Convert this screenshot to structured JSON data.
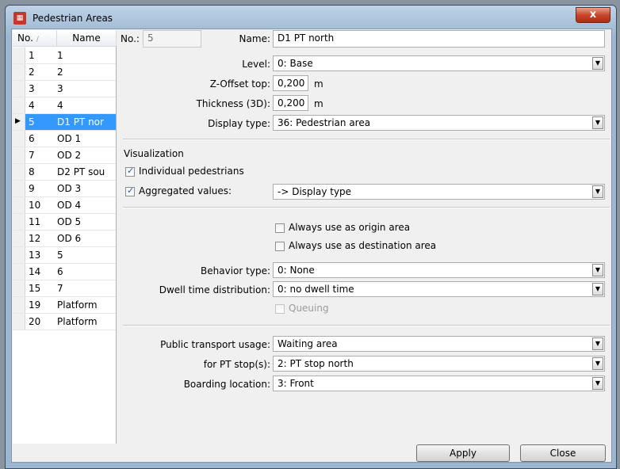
{
  "window": {
    "title": "Pedestrian Areas",
    "close_glyph": "x"
  },
  "list": {
    "headers": {
      "no": "No.",
      "name": "Name"
    },
    "rows": [
      {
        "no": "1",
        "name": "1"
      },
      {
        "no": "2",
        "name": "2"
      },
      {
        "no": "3",
        "name": "3"
      },
      {
        "no": "4",
        "name": "4"
      },
      {
        "no": "5",
        "name": "D1 PT nor"
      },
      {
        "no": "6",
        "name": "OD 1"
      },
      {
        "no": "7",
        "name": "OD 2"
      },
      {
        "no": "8",
        "name": "D2 PT sou"
      },
      {
        "no": "9",
        "name": "OD 3"
      },
      {
        "no": "10",
        "name": "OD 4"
      },
      {
        "no": "11",
        "name": "OD 5"
      },
      {
        "no": "12",
        "name": "OD 6"
      },
      {
        "no": "13",
        "name": "5"
      },
      {
        "no": "14",
        "name": "6"
      },
      {
        "no": "15",
        "name": "7"
      },
      {
        "no": "19",
        "name": "Platform"
      },
      {
        "no": "20",
        "name": "Platform"
      }
    ],
    "selected_index": 4
  },
  "form": {
    "no_label": "No.:",
    "no_value": "5",
    "name_label": "Name:",
    "name_value": "D1 PT north",
    "level_label": "Level:",
    "level_value": "0: Base",
    "zoffset_label": "Z-Offset top:",
    "zoffset_value": "0,200",
    "zoffset_unit": "m",
    "thickness_label": "Thickness (3D):",
    "thickness_value": "0,200",
    "thickness_unit": "m",
    "display_type_label": "Display type:",
    "display_type_value": "36: Pedestrian area",
    "visualization_heading": "Visualization",
    "individual_label": "Individual pedestrians",
    "individual_checked": true,
    "aggregated_label": "Aggregated values:",
    "aggregated_checked": true,
    "aggregated_value": "-> Display type",
    "origin_label": "Always use as origin area",
    "origin_checked": false,
    "destination_label": "Always use as destination area",
    "destination_checked": false,
    "behavior_label": "Behavior type:",
    "behavior_value": "0: None",
    "dwell_label": "Dwell time distribution:",
    "dwell_value": "0: no dwell time",
    "queuing_label": "Queuing",
    "queuing_checked": false,
    "pt_usage_label": "Public transport usage:",
    "pt_usage_value": "Waiting area",
    "pt_stop_label": "for PT stop(s):",
    "pt_stop_value": "2: PT stop north",
    "boarding_label": "Boarding location:",
    "boarding_value": "3: Front"
  },
  "buttons": {
    "apply": "Apply",
    "close": "Close"
  }
}
